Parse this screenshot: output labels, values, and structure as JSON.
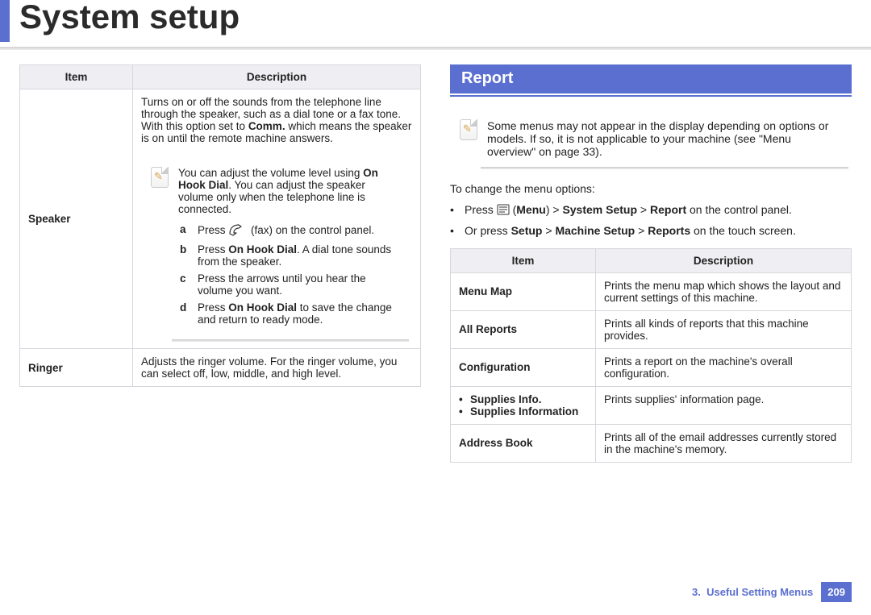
{
  "title": "System setup",
  "left_table": {
    "headers": [
      "Item",
      "Description"
    ],
    "rows": [
      {
        "item": "Speaker",
        "desc_intro_pre": "Turns on or off the sounds from the telephone line through the speaker, such as a dial tone or a fax tone. With this option set to ",
        "desc_intro_bold": "Comm.",
        "desc_intro_post": " which means the speaker is on until the remote machine answers.",
        "note_pre": "You can adjust the volume level using ",
        "note_bold": "On Hook Dial",
        "note_post": ". You can adjust the speaker volume only when the telephone line is connected.",
        "steps": {
          "a_pre": "Press ",
          "a_post": "(fax) on the control panel.",
          "b_pre": "Press ",
          "b_bold": "On Hook Dial",
          "b_post": ". A dial tone sounds from the speaker.",
          "c": "Press the arrows until you hear the volume you want.",
          "d_pre": "Press ",
          "d_bold": "On Hook Dial",
          "d_post": " to save the change and return to ready mode."
        }
      },
      {
        "item": "Ringer",
        "desc": "Adjusts the ringer volume. For the ringer volume, you can select off, low, middle, and high level."
      }
    ]
  },
  "right": {
    "section_title": "Report",
    "top_note": "Some menus may not appear in the display depending on options or models. If so, it is not applicable to your machine (see \"Menu overview\" on page 33).",
    "lead": "To change the menu options:",
    "bullets": {
      "b1_pre": "Press ",
      "b1_mid1": " (",
      "b1_bold1": "Menu",
      "b1_mid2": ") > ",
      "b1_bold2": "System Setup",
      "b1_mid3": " > ",
      "b1_bold3": "Report",
      "b1_post": " on the control panel.",
      "b2_pre": "Or press ",
      "b2_bold1": "Setup",
      "b2_mid1": " > ",
      "b2_bold2": "Machine Setup",
      "b2_mid2": " > ",
      "b2_bold3": "Reports",
      "b2_post": " on the touch screen."
    },
    "table": {
      "headers": [
        "Item",
        "Description"
      ],
      "rows": [
        {
          "item": "Menu Map",
          "desc": "Prints the menu map which shows the layout and current settings of this machine."
        },
        {
          "item": "All Reports",
          "desc": "Prints all kinds of reports that this machine provides."
        },
        {
          "item": "Configuration",
          "desc": "Prints a report on the machine's overall configuration."
        },
        {
          "item_multi": [
            "Supplies Info.",
            "Supplies Information"
          ],
          "desc": "Prints supplies' information page."
        },
        {
          "item": "Address Book",
          "desc": "Prints all of the email addresses currently stored in the machine's memory."
        }
      ]
    }
  },
  "footer": {
    "chapter_num": "3.",
    "chapter_title": "Useful Setting Menus",
    "page": "209"
  }
}
